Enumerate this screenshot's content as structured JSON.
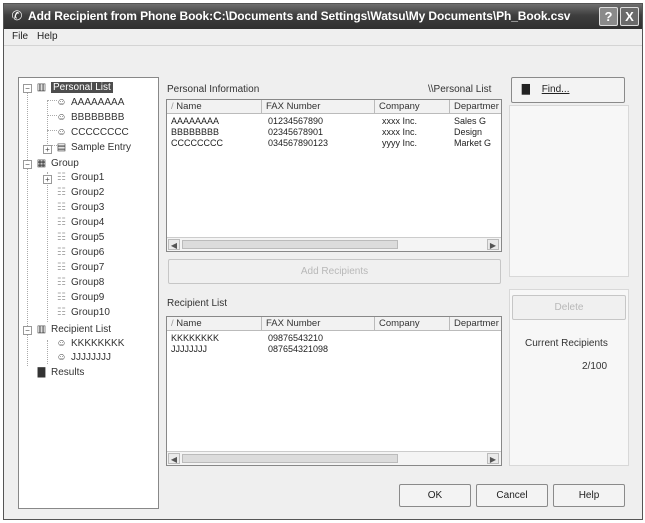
{
  "window": {
    "title": "Add Recipient from Phone Book:C:\\Documents and Settings\\Watsu\\My Documents\\Ph_Book.csv",
    "help_btn": "?",
    "close_btn": "X"
  },
  "menu": [
    "File",
    "Help"
  ],
  "tree": {
    "personal_list": "Personal List",
    "contacts": [
      "AAAAAAAA",
      "BBBBBBBB",
      "CCCCCCCC"
    ],
    "sample_entry": "Sample Entry",
    "group": "Group",
    "groups": [
      "Group1",
      "Group2",
      "Group3",
      "Group4",
      "Group5",
      "Group6",
      "Group7",
      "Group8",
      "Group9",
      "Group10"
    ],
    "recipient_list": "Recipient List",
    "recipients": [
      "KKKKKKKK",
      "JJJJJJJJ"
    ],
    "results": "Results"
  },
  "personal_info": {
    "label": "Personal Information",
    "path": "\\\\Personal List",
    "columns": [
      "Name",
      "FAX Number",
      "Company",
      "Departmer"
    ],
    "rows": [
      [
        "AAAAAAAA",
        "01234567890",
        "xxxx Inc.",
        "Sales G"
      ],
      [
        "BBBBBBBB",
        "02345678901",
        "xxxx Inc.",
        "Design"
      ],
      [
        "CCCCCCCC",
        "034567890123",
        "yyyy Inc.",
        "Market G"
      ]
    ]
  },
  "add_recipients_label": "Add Recipients",
  "recipient_list": {
    "label": "Recipient List",
    "columns": [
      "Name",
      "FAX Number",
      "Company",
      "Departmer"
    ],
    "rows": [
      [
        "KKKKKKKK",
        "09876543210",
        "",
        ""
      ],
      [
        "JJJJJJJJ",
        "087654321098",
        "",
        ""
      ]
    ]
  },
  "find_label": "Find...",
  "delete_label": "Delete",
  "current_recipients_label": "Current Recipients",
  "current_recipients_value": "2/100",
  "buttons": {
    "ok": "OK",
    "cancel": "Cancel",
    "help": "Help"
  }
}
